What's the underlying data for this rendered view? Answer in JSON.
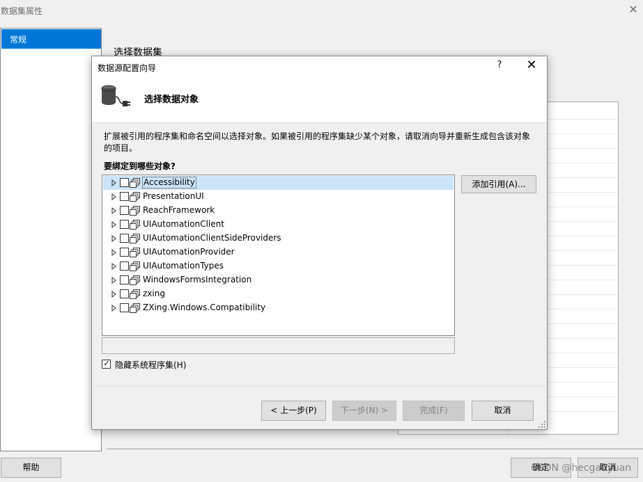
{
  "background_window": {
    "title": "数据集属性",
    "close_glyph": "✕",
    "nav_items": [
      {
        "label": "常规",
        "selected": true
      }
    ],
    "section_title": "选择数据集",
    "buttons": {
      "help": "帮助",
      "ok": "确定",
      "cancel": "取消"
    }
  },
  "watermark": "CSDN @hecgaoyuan",
  "wizard": {
    "title": "数据源配置向导",
    "help_glyph": "?",
    "close_glyph": "✕",
    "header_icon": "database-plug-icon",
    "heading": "选择数据对象",
    "description": "扩展被引用的程序集和命名空间以选择对象。如果被引用的程序集缺少某个对象，请取消向导并重新生成包含该对象的项目。",
    "question": "要绑定到哪些对象?",
    "assemblies": [
      {
        "name": "Accessibility",
        "selected": true
      },
      {
        "name": "PresentationUI",
        "selected": false
      },
      {
        "name": "ReachFramework",
        "selected": false
      },
      {
        "name": "UIAutomationClient",
        "selected": false
      },
      {
        "name": "UIAutomationClientSideProviders",
        "selected": false
      },
      {
        "name": "UIAutomationProvider",
        "selected": false
      },
      {
        "name": "UIAutomationTypes",
        "selected": false
      },
      {
        "name": "WindowsFormsIntegration",
        "selected": false
      },
      {
        "name": "zxing",
        "selected": false
      },
      {
        "name": "ZXing.Windows.Compatibility",
        "selected": false
      }
    ],
    "add_reference_label": "添加引用(A)...",
    "hide_system_label": "隐藏系统程序集(H)",
    "hide_system_checked": true,
    "buttons": {
      "prev": "< 上一步(P)",
      "next": "下一步(N) >",
      "finish": "完成(F)",
      "cancel": "取消"
    },
    "colors": {
      "selection": "#cce4f7",
      "accent": "#0078d7"
    }
  }
}
